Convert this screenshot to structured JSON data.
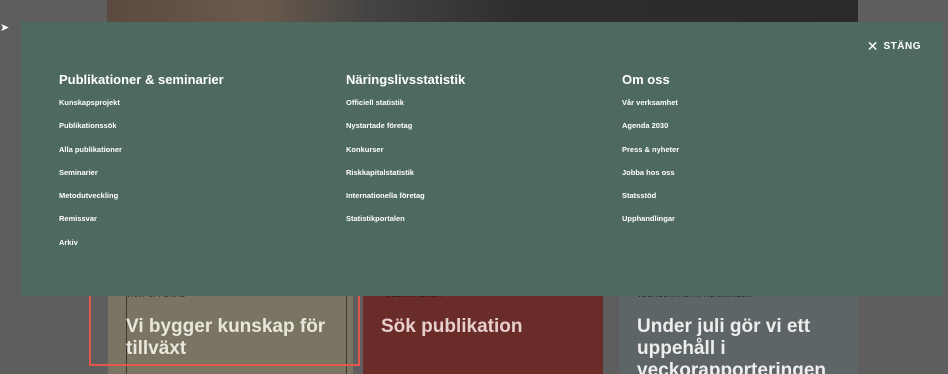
{
  "overlay": {
    "close_label": "STÄNG",
    "close_icon": "close-icon",
    "bg_color": "#4e6a5e",
    "columns": [
      {
        "title": "Publikationer & seminarier",
        "items": [
          "Kunskapsprojekt",
          "Publikationssök",
          "Alla publikationer",
          "Seminarier",
          "Metodutveckling",
          "Remissvar",
          "Arkiv"
        ]
      },
      {
        "title": "Näringslivsstatistik",
        "items": [
          "Officiell statistik",
          "Nystartade företag",
          "Konkurser",
          "Riskkapitalstatistik",
          "Internationella företag",
          "Statistikportalen"
        ]
      },
      {
        "title": "Om oss",
        "items": [
          "Vår verksamhet",
          "Agenda 2030",
          "Press & nyheter",
          "Jobba hos oss",
          "Statsstöd",
          "Upphandlingar"
        ]
      }
    ]
  },
  "cards": [
    {
      "eyebrow": "VÅRT UPPDRAG",
      "title": "Vi bygger kunskap för tillväxt"
    },
    {
      "eyebrow": "PUBLIKATIONER",
      "title": "Sök publikation"
    },
    {
      "eyebrow": "VECKOSTATISTIK KONKURSER",
      "title": "Under juli gör vi ett uppehåll i veckorapporteringen"
    }
  ],
  "highlight_color": "#e3564a"
}
